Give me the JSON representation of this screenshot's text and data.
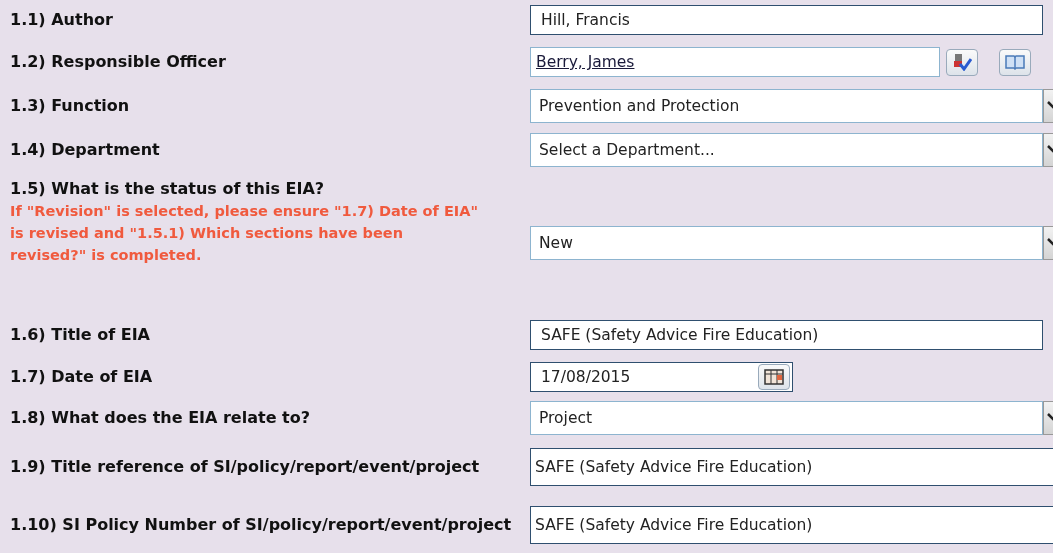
{
  "fields": [
    {
      "label": "1.1) Author",
      "kind": "text",
      "value": "Hill, Francis"
    },
    {
      "label": "1.2) Responsible Officer",
      "kind": "lookup",
      "value": "Berry, James"
    },
    {
      "label": "1.3) Function",
      "kind": "select",
      "value": "Prevention and Protection"
    },
    {
      "label": "1.4) Department",
      "kind": "select",
      "value": "Select a Department..."
    },
    {
      "label": "1.5) What is the status of this EIA?",
      "note": "If \"Revision\" is selected, please ensure \"1.7) Date of EIA\" is revised and \"1.5.1) Which sections have been revised?\" is completed.",
      "kind": "select",
      "value": "New"
    },
    {
      "label": "1.6) Title of EIA",
      "kind": "text",
      "value": "SAFE (Safety Advice Fire Education)"
    },
    {
      "label": "1.7) Date of EIA",
      "kind": "date",
      "value": "17/08/2015"
    },
    {
      "label": "1.8) What does the EIA relate to?",
      "kind": "select",
      "value": "Project"
    },
    {
      "label": "1.9) Title reference of SI/policy/report/event/project",
      "kind": "text",
      "value": "SAFE (Safety Advice Fire Education)"
    },
    {
      "label": "1.10) SI Policy Number of SI/policy/report/event/project",
      "kind": "text",
      "value": "SAFE (Safety Advice Fire Education)"
    }
  ]
}
